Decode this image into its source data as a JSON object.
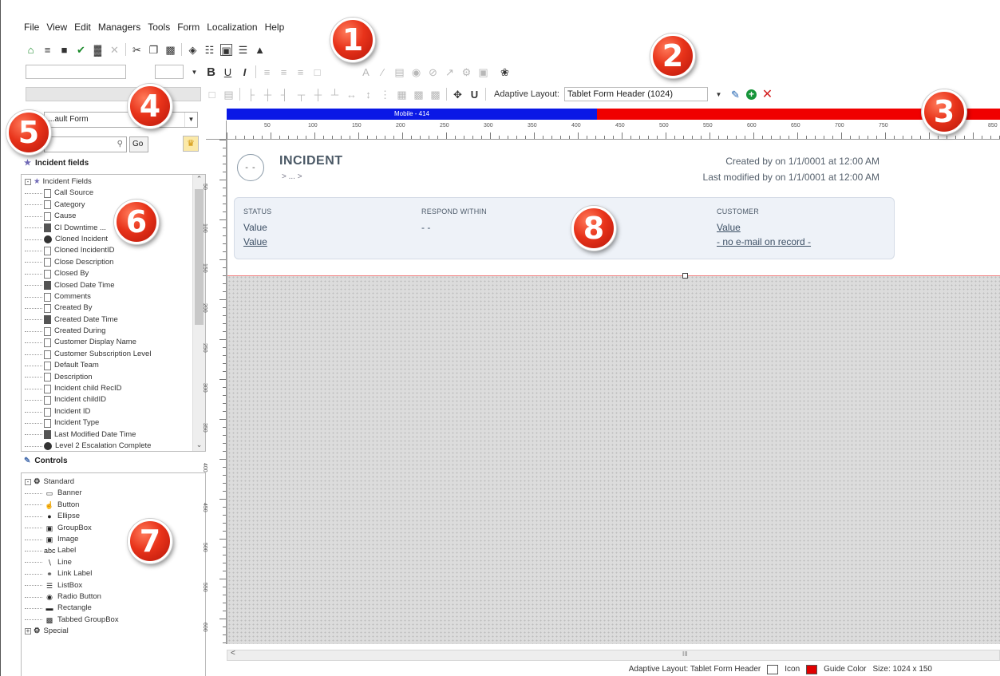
{
  "menu": [
    "File",
    "View",
    "Edit",
    "Managers",
    "Tools",
    "Form",
    "Localization",
    "Help"
  ],
  "toolbar": {
    "bold": "B",
    "underline": "U",
    "italic": "I",
    "adaptive_layout_label": "Adaptive Layout:",
    "adaptive_layout_value": "Tablet Form Header (1024)"
  },
  "left_pane": {
    "form_selector": "...ault Form",
    "go_button": "Go",
    "fields_section_title": "Incident fields",
    "fields_root": "Incident Fields",
    "fields": [
      {
        "label": "Call Source",
        "icon": "field"
      },
      {
        "label": "Category",
        "icon": "field"
      },
      {
        "label": "Cause",
        "icon": "field"
      },
      {
        "label": "CI Downtime ...",
        "icon": "calc"
      },
      {
        "label": "Cloned Incident",
        "icon": "link"
      },
      {
        "label": "Cloned IncidentID",
        "icon": "field"
      },
      {
        "label": "Close Description",
        "icon": "field"
      },
      {
        "label": "Closed By",
        "icon": "field"
      },
      {
        "label": "Closed Date Time",
        "icon": "calendar"
      },
      {
        "label": "Comments",
        "icon": "field"
      },
      {
        "label": "Created By",
        "icon": "field"
      },
      {
        "label": "Created Date Time",
        "icon": "calendar"
      },
      {
        "label": "Created During",
        "icon": "field"
      },
      {
        "label": "Customer Display Name",
        "icon": "field"
      },
      {
        "label": "Customer Subscription Level",
        "icon": "field"
      },
      {
        "label": "Default Team",
        "icon": "field"
      },
      {
        "label": "Description",
        "icon": "field"
      },
      {
        "label": "Incident child RecID",
        "icon": "field"
      },
      {
        "label": "Incident childID",
        "icon": "field"
      },
      {
        "label": "Incident ID",
        "icon": "field"
      },
      {
        "label": "Incident Type",
        "icon": "field"
      },
      {
        "label": "Last Modified Date Time",
        "icon": "calendar"
      },
      {
        "label": "Level 2 Escalation Complete",
        "icon": "link"
      }
    ],
    "controls_section_title": "Controls",
    "controls_root": "Standard",
    "controls": [
      "Banner",
      "Button",
      "Ellipse",
      "GroupBox",
      "Image",
      "Label",
      "Line",
      "Link Label",
      "ListBox",
      "Radio Button",
      "Rectangle",
      "Tabbed GroupBox"
    ],
    "special_root": "Special"
  },
  "adaptive_bar": {
    "mobile_label": "Mobile - 414"
  },
  "ruler": {
    "marks": [
      "50",
      "100",
      "150",
      "200",
      "250",
      "300",
      "350",
      "400",
      "450",
      "500",
      "550",
      "600",
      "650",
      "700",
      "750",
      "850"
    ]
  },
  "ruler_left": {
    "marks": [
      "50",
      "100",
      "150",
      "200",
      "250",
      "300",
      "350",
      "400",
      "450",
      "500",
      "550",
      "600"
    ]
  },
  "form_header": {
    "avatar_text": "- -",
    "title": "INCIDENT",
    "subtitle": "> ... >",
    "created": "Created by  on 1/1/0001 at 12:00 AM",
    "modified": "Last modified by  on 1/1/0001 at 12:00 AM",
    "status_label": "STATUS",
    "status_value1": "Value",
    "status_value2": "Value",
    "respond_label": "RESPOND WITHIN",
    "respond_value": "- -",
    "customer_label": "CUSTOMER",
    "customer_value": "Value",
    "customer_email": "- no e-mail on record -"
  },
  "hscroll": {
    "grip": "III"
  },
  "statusbar": {
    "adaptive": "Adaptive Layout: Tablet Form Header",
    "icon_label": "Icon",
    "guide_label": "Guide Color",
    "size": "Size: 1024 x 150",
    "guide_color": "#e00000"
  },
  "callouts": [
    "1",
    "2",
    "3",
    "4",
    "5",
    "6",
    "7",
    "8"
  ]
}
